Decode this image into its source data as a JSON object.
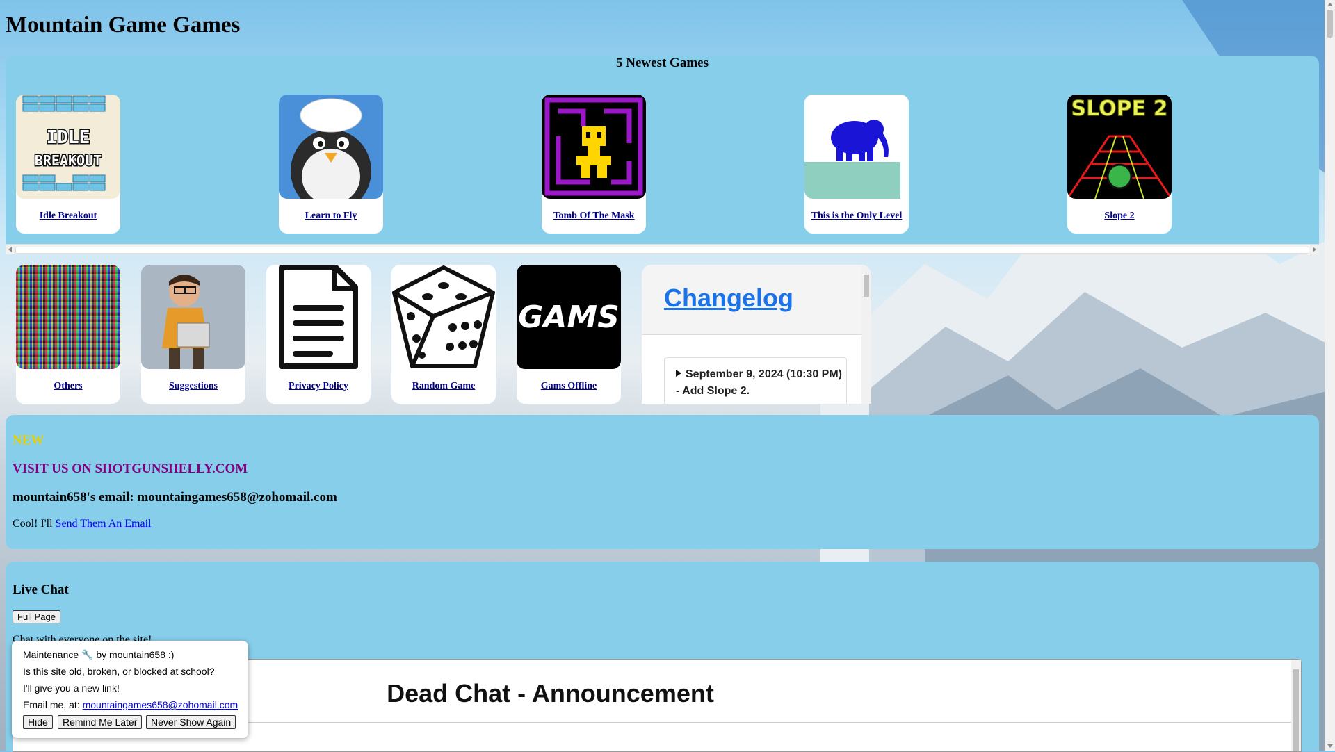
{
  "site": {
    "title": "Mountain Game Games"
  },
  "newest": {
    "title": "5 Newest Games",
    "games": [
      {
        "label": "Idle Breakout",
        "icon": "idle-breakout-thumbnail"
      },
      {
        "label": "Learn to Fly",
        "icon": "penguin-thumbnail"
      },
      {
        "label": "Tomb Of The Mask",
        "icon": "tomb-mask-thumbnail"
      },
      {
        "label": "This is the Only Level",
        "icon": "elephant-thumbnail"
      },
      {
        "label": "Slope 2",
        "icon": "slope-thumbnail"
      }
    ],
    "thumb_text": {
      "idle_top": "IDLE",
      "idle_bottom": "BREAKOUT",
      "slope": "SLOPE 2"
    }
  },
  "links": [
    {
      "label": "Others",
      "icon": "noise-thumbnail"
    },
    {
      "label": "Suggestions",
      "icon": "suggestions-thumbnail"
    },
    {
      "label": "Privacy Policy",
      "icon": "document-icon"
    },
    {
      "label": "Random Game",
      "icon": "dice-icon"
    },
    {
      "label": "Gams Offline",
      "icon": "gams-logo"
    }
  ],
  "gams_text": "GAMS",
  "changelog": {
    "title": "Changelog",
    "entry": "September 9, 2024 (10:30 PM) - Add Slope 2."
  },
  "info": {
    "new": "NEW",
    "visit": "VISIT US ON SHOTGUNSHELLY.COM",
    "email": "mountain658's email: mountaingames658@zohomail.com",
    "cool_prefix": "Cool! I'll",
    "cool_link": "Send Them An Email"
  },
  "chat": {
    "title": "Live Chat",
    "full_page": "Full Page",
    "subtitle": "Chat with everyone on the site!",
    "frame_title": "Dead Chat - Announcement"
  },
  "popup": {
    "line1": "Maintenance 🔧 by mountain658 :)",
    "line2": "Is this site old, broken, or blocked at school?",
    "line3": "I'll give you a new link!",
    "line4_prefix": "Email me, at:",
    "line4_link": "mountaingames658@zohomail.com",
    "hide": "Hide",
    "remind": "Remind Me Later",
    "never": "Never Show Again"
  },
  "colors": {
    "panel": "#87ceeb",
    "link": "#00008b",
    "new": "#e8d000",
    "visit": "#800080",
    "changelog": "#1a73e8"
  }
}
